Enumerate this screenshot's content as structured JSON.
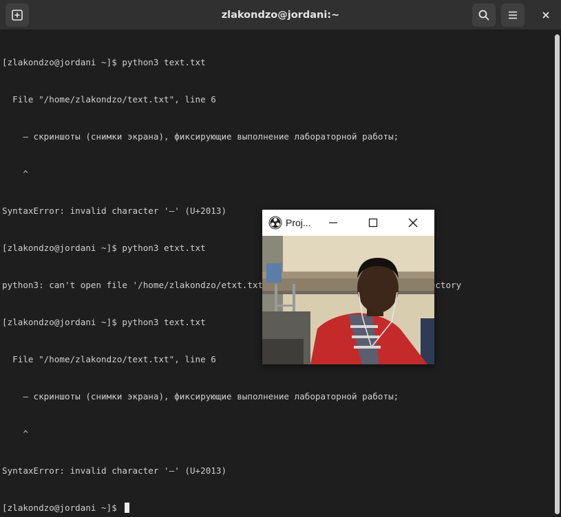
{
  "window": {
    "title": "zlakondzo@jordani:~"
  },
  "header": {
    "new_tab_icon": "new-tab-icon",
    "search_icon": "search-icon",
    "menu_icon": "hamburger-menu-icon",
    "close_icon": "close-icon"
  },
  "terminal": {
    "lines": [
      "[zlakondzo@jordani ~]$ python3 text.txt",
      "  File \"/home/zlakondzo/text.txt\", line 6",
      "    – скриншоты (снимки экрана), фиксирующие выполнение лабораторной работы;",
      "    ^",
      "SyntaxError: invalid character '–' (U+2013)",
      "[zlakondzo@jordani ~]$ python3 etxt.txt",
      "python3: can't open file '/home/zlakondzo/etxt.txt': [Errno 2] No such file or directory",
      "[zlakondzo@jordani ~]$ python3 text.txt",
      "  File \"/home/zlakondzo/text.txt\", line 6",
      "    – скриншоты (снимки экрана), фиксирующие выполнение лабораторной работы;",
      "    ^",
      "SyntaxError: invalid character '–' (U+2013)"
    ],
    "prompt": "[zlakondzo@jordani ~]$ "
  },
  "projector": {
    "title": "Proj...",
    "logo_icon": "obs-logo-icon"
  },
  "colors": {
    "headerbar": "#303030",
    "terminal_bg": "#1e1e1e",
    "terminal_fg": "#d0d0d0"
  }
}
